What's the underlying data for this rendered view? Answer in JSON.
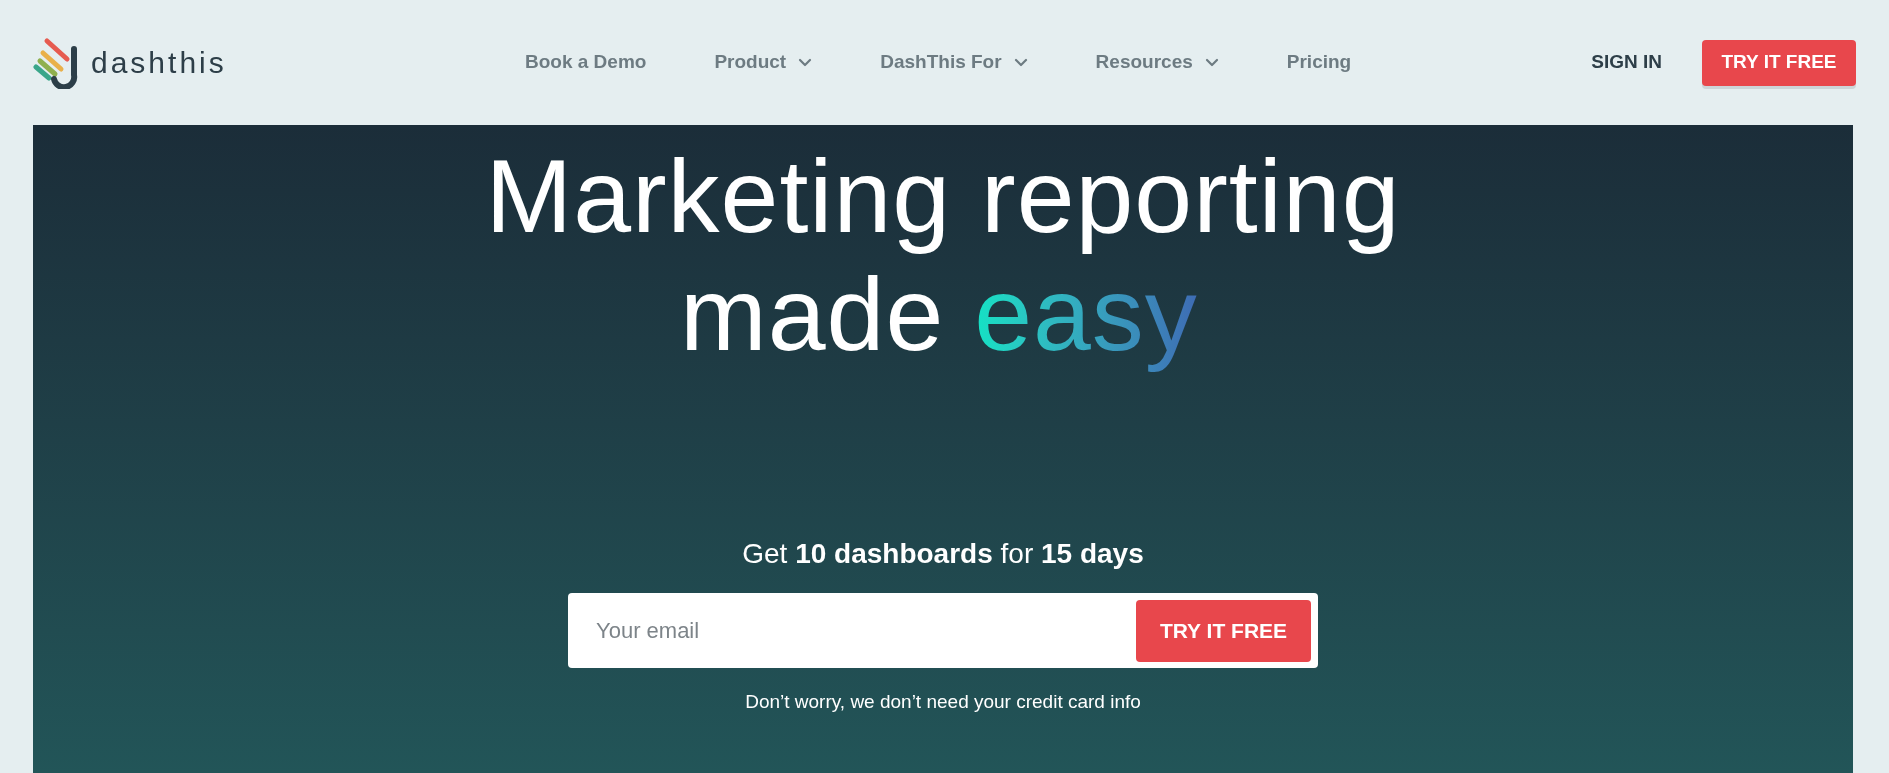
{
  "header": {
    "logo_text": "dashthis",
    "nav": [
      {
        "label": "Book a Demo",
        "has_dropdown": false
      },
      {
        "label": "Product",
        "has_dropdown": true
      },
      {
        "label": "DashThis For",
        "has_dropdown": true
      },
      {
        "label": "Resources",
        "has_dropdown": true
      },
      {
        "label": "Pricing",
        "has_dropdown": false
      }
    ],
    "sign_in": "SIGN IN",
    "cta": "TRY IT FREE"
  },
  "hero": {
    "headline_line_1": "Marketing reporting",
    "headline_line_2": "made",
    "headline_highlight": "easy",
    "offer": "Get **10 dashboards** for **15 days**",
    "email_field": {
      "placeholder": "Your email"
    },
    "submit": "TRY IT FREE",
    "note": "Don’t worry, we don’t need your credit card info"
  }
}
